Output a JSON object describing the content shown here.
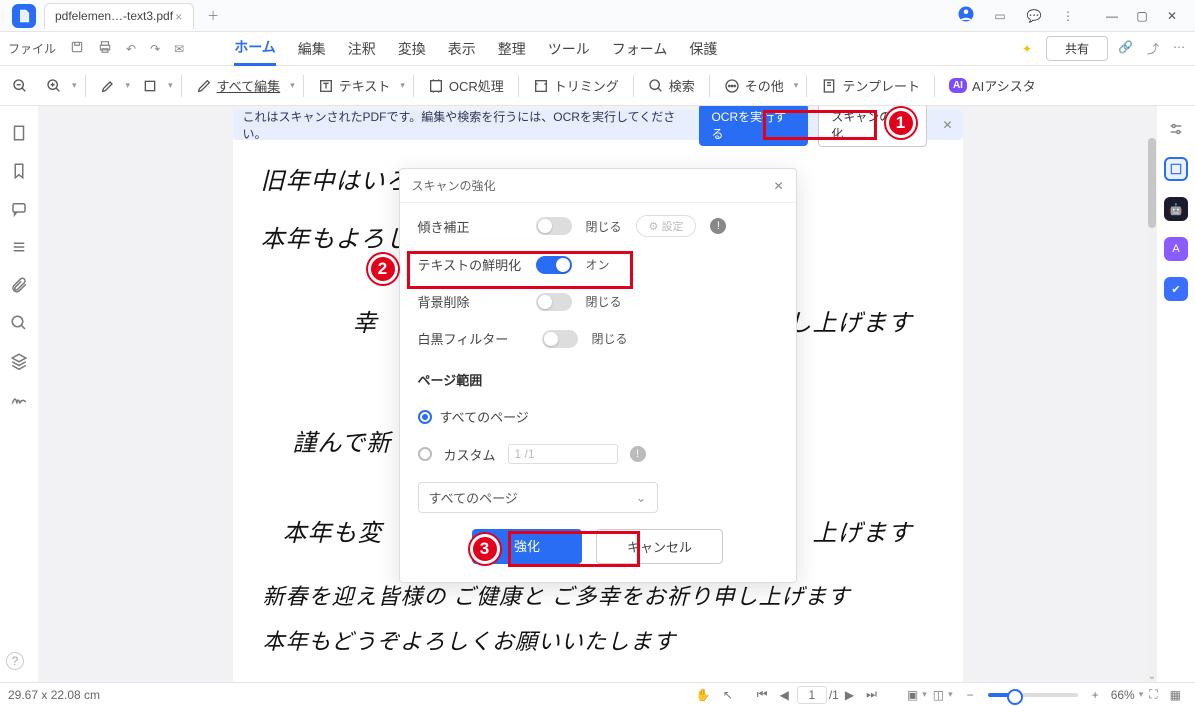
{
  "window": {
    "tab_title": "pdfelemen…-text3.pdf"
  },
  "menu": {
    "file": "ファイル",
    "tabs": {
      "home": "ホーム",
      "edit": "編集",
      "annotate": "注釈",
      "convert": "変換",
      "view": "表示",
      "organize": "整理",
      "tools": "ツール",
      "forms": "フォーム",
      "protect": "保護"
    },
    "share": "共有"
  },
  "toolbar": {
    "edit_all": "すべて編集",
    "text": "テキスト",
    "ocr": "OCR処理",
    "trim": "トリミング",
    "search": "検索",
    "more": "その他",
    "template": "テンプレート",
    "ai": "AI",
    "ai_assist": "AIアシスタ"
  },
  "banner": {
    "msg": "これはスキャンされたPDFです。編集や検索を行うには、OCRを実行してください。",
    "run_ocr": "OCRを実行する",
    "enhance_scan": "スキャンの強化"
  },
  "modal": {
    "title": "スキャンの強化",
    "deskew": "傾き補正",
    "sharpen": "テキストの鮮明化",
    "remove_bg": "背景削除",
    "bw_filter": "白黒フィルター",
    "state_off": "閉じる",
    "state_on": "オン",
    "settings": "設定",
    "range_title": "ページ範囲",
    "range_all": "すべてのページ",
    "range_custom": "カスタム",
    "range_input": "1 /1",
    "select_value": "すべてのページ",
    "primary": "強化",
    "cancel": "キャンセル"
  },
  "document": {
    "lines": [
      "旧年中はいろいろお世話になりました",
      "本年もよろしく",
      "幸",
      "謹んで新",
      "本年も変",
      "新春を迎え皆様の ご健康と ご多幸をお祈り申し上げます",
      "本年もどうぞよろしくお願いいたします"
    ],
    "right_fragments": {
      "a": "り申し上げます",
      "b": "上げます"
    }
  },
  "status": {
    "dims": "29.67 x 22.08 cm",
    "page_current": "1",
    "page_total": "/1",
    "zoom": "66%"
  },
  "markers": {
    "m1": "1",
    "m2": "2",
    "m3": "3"
  },
  "colors": {
    "accent": "#2a6df5",
    "marker": "#e3001b"
  }
}
